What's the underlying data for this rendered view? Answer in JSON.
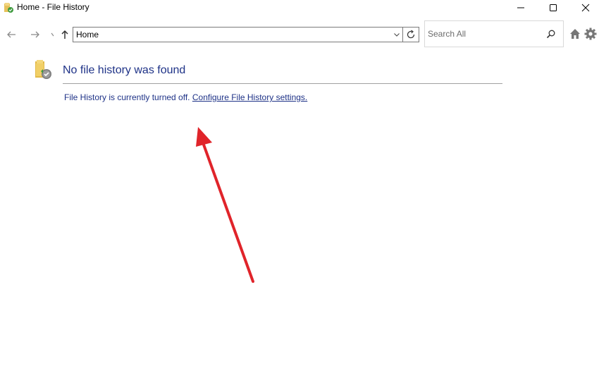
{
  "window": {
    "title": "Home - File History"
  },
  "address_bar": {
    "path": "Home"
  },
  "search": {
    "placeholder": "Search All"
  },
  "content": {
    "heading": "No file history was found",
    "status_text": "File History is currently turned off.",
    "link_text": "Configure File History settings."
  },
  "colors": {
    "heading_text": "#1e3287",
    "annotation_arrow": "#e0242a"
  },
  "icons": {
    "app": "file-history-icon",
    "back": "arrow-left-icon",
    "forward": "arrow-right-icon",
    "up": "arrow-up-icon",
    "refresh": "refresh-icon",
    "search": "search-icon",
    "home": "home-icon",
    "settings": "gear-icon"
  }
}
